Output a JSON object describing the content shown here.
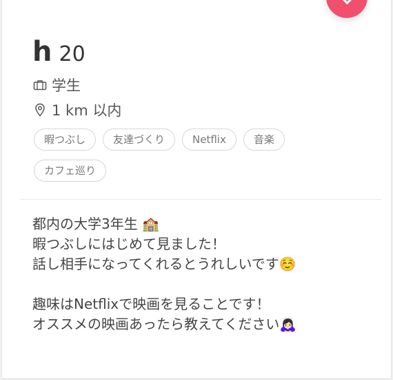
{
  "profile": {
    "name": "h",
    "age": "20",
    "job": "学生",
    "distance": "1 km 以内",
    "job_icon": "briefcase-icon",
    "distance_icon": "location-pin-icon"
  },
  "interests": [
    "暇つぶし",
    "友達づくり",
    "Netflix",
    "音楽",
    "カフェ巡り"
  ],
  "bio": "都内の大学3年生 🏫\n暇つぶしにはじめて見ました！\n話し相手になってくれるとうれしいです☺️\n\n趣味はNetflixで映画を見ることです！\nオススメの映画あったら教えてください🙇🏻‍♀️",
  "colors": {
    "like_button": "#f0506e",
    "text_primary": "#333333",
    "tag_border": "#d6d6d6"
  }
}
